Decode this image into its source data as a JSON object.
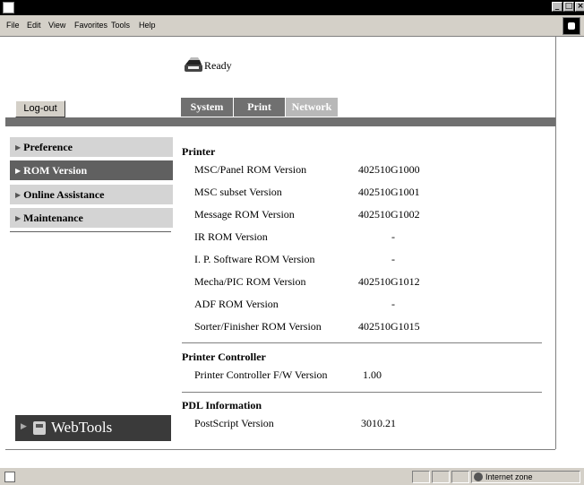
{
  "menu": [
    "File",
    "Edit",
    "View",
    "Favorites",
    "Tools",
    "Help"
  ],
  "status": "Ready",
  "logout_label": "Log-out",
  "tabs": [
    "System",
    "Print",
    "Network"
  ],
  "sidebar": {
    "items": [
      {
        "label": "Preference"
      },
      {
        "label": "ROM Version",
        "active": true
      },
      {
        "label": "Online Assistance"
      },
      {
        "label": "Maintenance"
      }
    ],
    "webtools_label": "WebTools"
  },
  "sections": [
    {
      "title": "Printer",
      "rows": [
        {
          "label": "MSC/Panel ROM Version",
          "value": "402510G1000"
        },
        {
          "label": "MSC subset Version",
          "value": "402510G1001"
        },
        {
          "label": "Message ROM Version",
          "value": "402510G1002"
        },
        {
          "label": "IR ROM Version",
          "value": "-"
        },
        {
          "label": "I. P. Software ROM Version",
          "value": "-"
        },
        {
          "label": "Mecha/PIC ROM Version",
          "value": "402510G1012"
        },
        {
          "label": "ADF ROM Version",
          "value": "-"
        },
        {
          "label": "Sorter/Finisher ROM Version",
          "value": "402510G1015"
        }
      ]
    },
    {
      "title": "Printer Controller",
      "rows": [
        {
          "label": "Printer Controller F/W Version",
          "value": "1.00"
        }
      ]
    },
    {
      "title": "PDL Information",
      "rows": [
        {
          "label": "PostScript Version",
          "value": "3010.21"
        }
      ]
    }
  ],
  "statusbar": {
    "zone": "Internet zone"
  }
}
